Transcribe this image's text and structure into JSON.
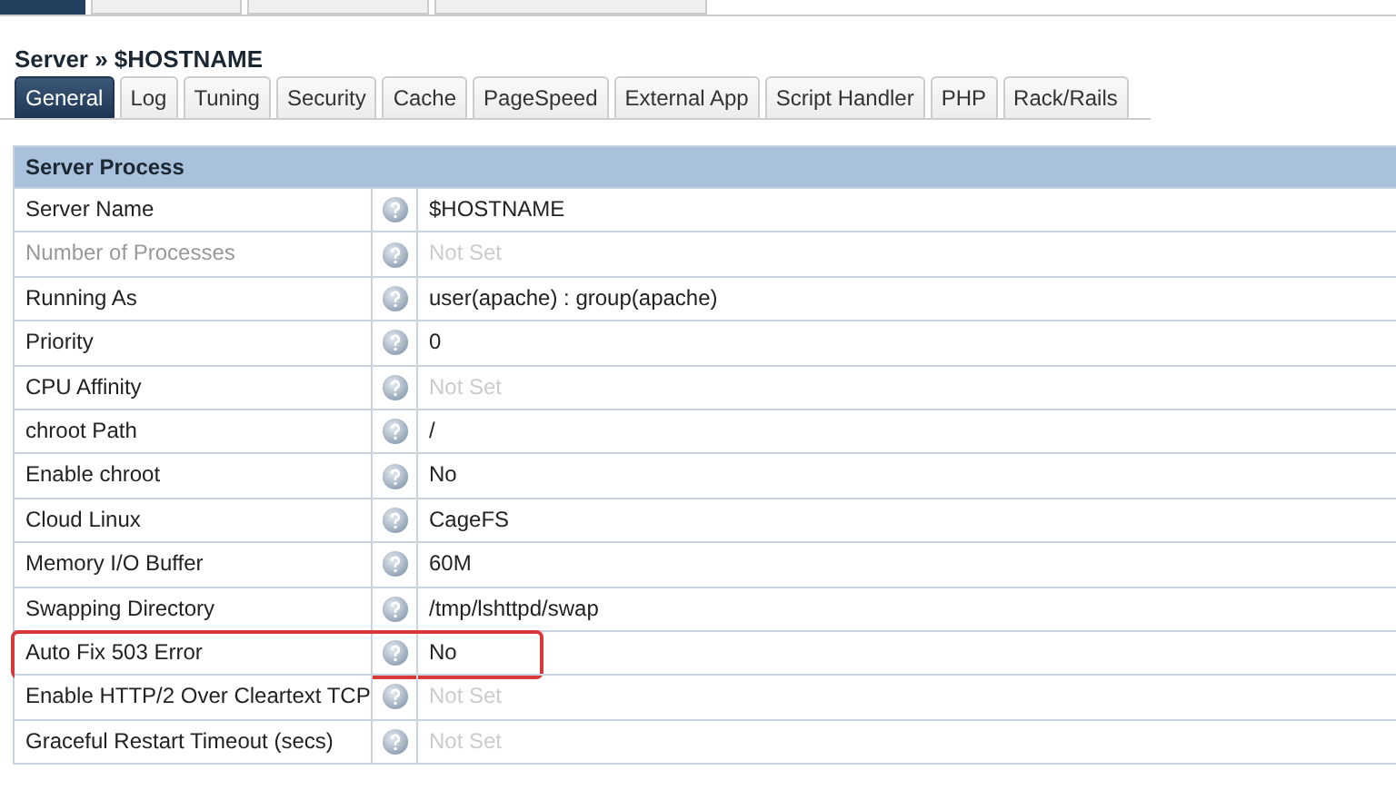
{
  "top_tabs": [
    {
      "selected": true
    },
    {
      "selected": false
    },
    {
      "selected": false
    },
    {
      "selected": false
    }
  ],
  "breadcrumb": "Server » $HOSTNAME",
  "tabs": [
    {
      "label": "General",
      "selected": true
    },
    {
      "label": "Log",
      "selected": false
    },
    {
      "label": "Tuning",
      "selected": false
    },
    {
      "label": "Security",
      "selected": false
    },
    {
      "label": "Cache",
      "selected": false
    },
    {
      "label": "PageSpeed",
      "selected": false
    },
    {
      "label": "External App",
      "selected": false
    },
    {
      "label": "Script Handler",
      "selected": false
    },
    {
      "label": "PHP",
      "selected": false
    },
    {
      "label": "Rack/Rails",
      "selected": false
    }
  ],
  "section": {
    "title": "Server Process",
    "rows": [
      {
        "label": "Server Name",
        "value": "$HOSTNAME",
        "label_disabled": false,
        "value_unset": false,
        "highlighted": false
      },
      {
        "label": "Number of Processes",
        "value": "Not Set",
        "label_disabled": true,
        "value_unset": true,
        "highlighted": false
      },
      {
        "label": "Running As",
        "value": "user(apache) : group(apache)",
        "label_disabled": false,
        "value_unset": false,
        "highlighted": false
      },
      {
        "label": "Priority",
        "value": "0",
        "label_disabled": false,
        "value_unset": false,
        "highlighted": false
      },
      {
        "label": "CPU Affinity",
        "value": "Not Set",
        "label_disabled": false,
        "value_unset": true,
        "highlighted": false
      },
      {
        "label": "chroot Path",
        "value": "/",
        "label_disabled": false,
        "value_unset": false,
        "highlighted": false
      },
      {
        "label": "Enable chroot",
        "value": "No",
        "label_disabled": false,
        "value_unset": false,
        "highlighted": false
      },
      {
        "label": "Cloud Linux",
        "value": "CageFS",
        "label_disabled": false,
        "value_unset": false,
        "highlighted": false
      },
      {
        "label": "Memory I/O Buffer",
        "value": "60M",
        "label_disabled": false,
        "value_unset": false,
        "highlighted": false
      },
      {
        "label": "Swapping Directory",
        "value": "/tmp/lshttpd/swap",
        "label_disabled": false,
        "value_unset": false,
        "highlighted": false
      },
      {
        "label": "Auto Fix 503 Error",
        "value": "No",
        "label_disabled": false,
        "value_unset": false,
        "highlighted": true
      },
      {
        "label": "Enable HTTP/2 Over Cleartext TCP",
        "value": "Not Set",
        "label_disabled": false,
        "value_unset": true,
        "highlighted": false
      },
      {
        "label": "Graceful Restart Timeout (secs)",
        "value": "Not Set",
        "label_disabled": false,
        "value_unset": true,
        "highlighted": false
      }
    ]
  }
}
